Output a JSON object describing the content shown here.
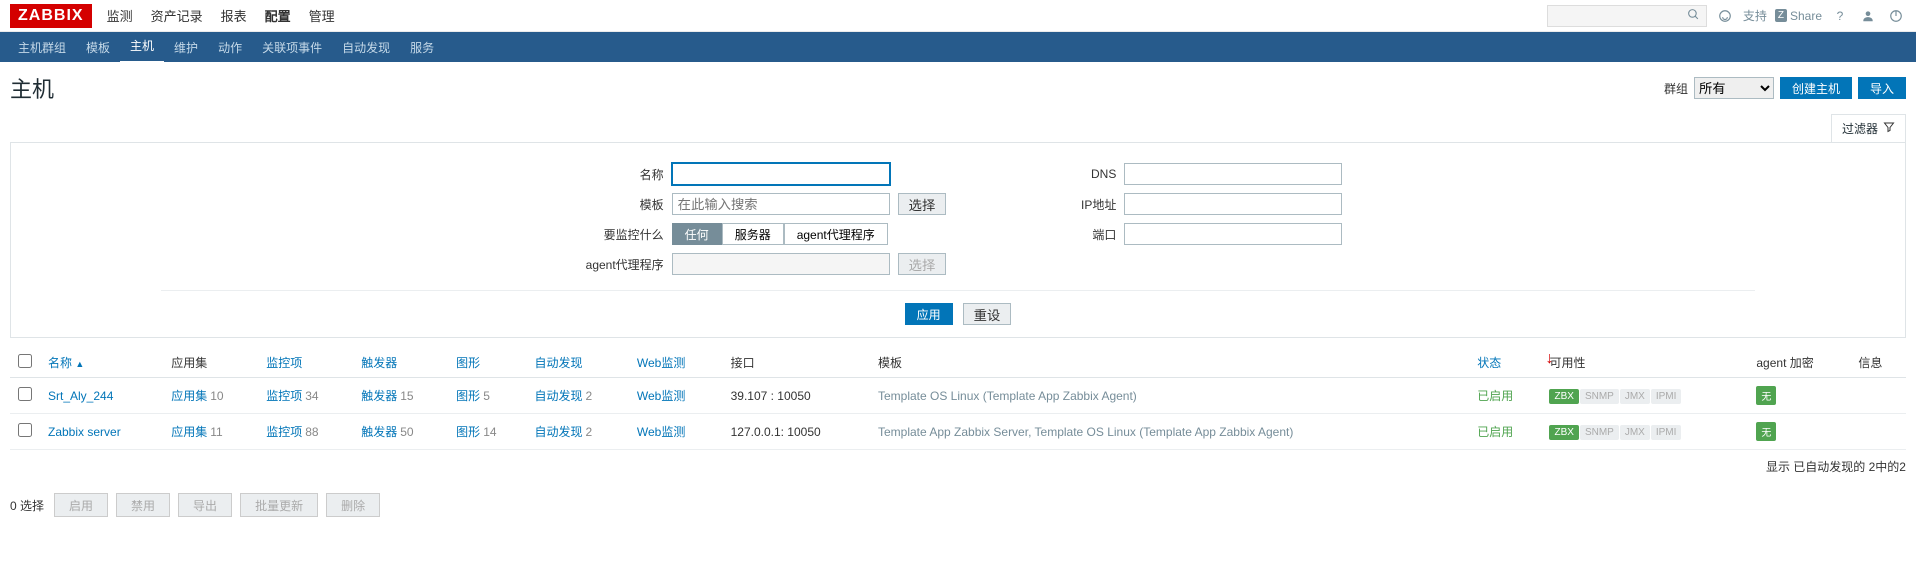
{
  "logo": "ZABBIX",
  "top_menu": [
    "监测",
    "资产记录",
    "报表",
    "配置",
    "管理"
  ],
  "top_active": 3,
  "support_label": "支持",
  "share_label": "Share",
  "sub_menu": [
    "主机群组",
    "模板",
    "主机",
    "维护",
    "动作",
    "关联项事件",
    "自动发现",
    "服务"
  ],
  "sub_active": 2,
  "page_title": "主机",
  "group_label": "群组",
  "group_value": "所有",
  "btn_create": "创建主机",
  "btn_import": "导入",
  "filter_tab": "过滤器",
  "filter": {
    "name_label": "名称",
    "template_label": "模板",
    "template_placeholder": "在此输入搜索",
    "template_select": "选择",
    "monitor_label": "要监控什么",
    "monitor_opts": [
      "任何",
      "服务器",
      "agent代理程序"
    ],
    "proxy_label": "agent代理程序",
    "proxy_select": "选择",
    "dns_label": "DNS",
    "ip_label": "IP地址",
    "port_label": "端口",
    "btn_apply": "应用",
    "btn_reset": "重设"
  },
  "columns": {
    "name": "名称",
    "apps": "应用集",
    "items": "监控项",
    "triggers": "触发器",
    "graphs": "图形",
    "discovery": "自动发现",
    "web": "Web监测",
    "interface": "接口",
    "templates": "模板",
    "status": "状态",
    "availability": "可用性",
    "encryption": "agent 加密",
    "info": "信息"
  },
  "rows": [
    {
      "name": "Srt_Aly_244",
      "apps": "10",
      "items": "34",
      "triggers": "15",
      "graphs": "5",
      "discovery": "2",
      "web": "",
      "interface": "39.107             : 10050",
      "templates": "Template OS Linux (Template App Zabbix Agent)",
      "status": "已启用",
      "encrypt": "无"
    },
    {
      "name": "Zabbix server",
      "apps": "11",
      "items": "88",
      "triggers": "50",
      "graphs": "14",
      "discovery": "2",
      "web": "",
      "interface": "127.0.0.1: 10050",
      "templates": "Template App Zabbix Server, Template OS Linux (Template App Zabbix Agent)",
      "status": "已启用",
      "encrypt": "无"
    }
  ],
  "avail_labels": [
    "ZBX",
    "SNMP",
    "JMX",
    "IPMI"
  ],
  "footer_text": "显示 已自动发现的 2中的2",
  "selected_text": "0 选择",
  "action_buttons": [
    "启用",
    "禁用",
    "导出",
    "批量更新",
    "删除"
  ]
}
